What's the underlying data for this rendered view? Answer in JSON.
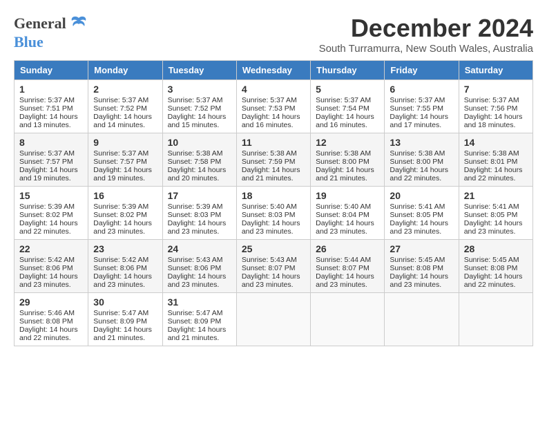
{
  "logo": {
    "general": "General",
    "blue": "Blue"
  },
  "title": "December 2024",
  "subtitle": "South Turramurra, New South Wales, Australia",
  "weekdays": [
    "Sunday",
    "Monday",
    "Tuesday",
    "Wednesday",
    "Thursday",
    "Friday",
    "Saturday"
  ],
  "weeks": [
    [
      {
        "day": "1",
        "sunrise": "Sunrise: 5:37 AM",
        "sunset": "Sunset: 7:51 PM",
        "daylight": "Daylight: 14 hours and 13 minutes."
      },
      {
        "day": "2",
        "sunrise": "Sunrise: 5:37 AM",
        "sunset": "Sunset: 7:52 PM",
        "daylight": "Daylight: 14 hours and 14 minutes."
      },
      {
        "day": "3",
        "sunrise": "Sunrise: 5:37 AM",
        "sunset": "Sunset: 7:52 PM",
        "daylight": "Daylight: 14 hours and 15 minutes."
      },
      {
        "day": "4",
        "sunrise": "Sunrise: 5:37 AM",
        "sunset": "Sunset: 7:53 PM",
        "daylight": "Daylight: 14 hours and 16 minutes."
      },
      {
        "day": "5",
        "sunrise": "Sunrise: 5:37 AM",
        "sunset": "Sunset: 7:54 PM",
        "daylight": "Daylight: 14 hours and 16 minutes."
      },
      {
        "day": "6",
        "sunrise": "Sunrise: 5:37 AM",
        "sunset": "Sunset: 7:55 PM",
        "daylight": "Daylight: 14 hours and 17 minutes."
      },
      {
        "day": "7",
        "sunrise": "Sunrise: 5:37 AM",
        "sunset": "Sunset: 7:56 PM",
        "daylight": "Daylight: 14 hours and 18 minutes."
      }
    ],
    [
      {
        "day": "8",
        "sunrise": "Sunrise: 5:37 AM",
        "sunset": "Sunset: 7:57 PM",
        "daylight": "Daylight: 14 hours and 19 minutes."
      },
      {
        "day": "9",
        "sunrise": "Sunrise: 5:37 AM",
        "sunset": "Sunset: 7:57 PM",
        "daylight": "Daylight: 14 hours and 19 minutes."
      },
      {
        "day": "10",
        "sunrise": "Sunrise: 5:38 AM",
        "sunset": "Sunset: 7:58 PM",
        "daylight": "Daylight: 14 hours and 20 minutes."
      },
      {
        "day": "11",
        "sunrise": "Sunrise: 5:38 AM",
        "sunset": "Sunset: 7:59 PM",
        "daylight": "Daylight: 14 hours and 21 minutes."
      },
      {
        "day": "12",
        "sunrise": "Sunrise: 5:38 AM",
        "sunset": "Sunset: 8:00 PM",
        "daylight": "Daylight: 14 hours and 21 minutes."
      },
      {
        "day": "13",
        "sunrise": "Sunrise: 5:38 AM",
        "sunset": "Sunset: 8:00 PM",
        "daylight": "Daylight: 14 hours and 22 minutes."
      },
      {
        "day": "14",
        "sunrise": "Sunrise: 5:38 AM",
        "sunset": "Sunset: 8:01 PM",
        "daylight": "Daylight: 14 hours and 22 minutes."
      }
    ],
    [
      {
        "day": "15",
        "sunrise": "Sunrise: 5:39 AM",
        "sunset": "Sunset: 8:02 PM",
        "daylight": "Daylight: 14 hours and 22 minutes."
      },
      {
        "day": "16",
        "sunrise": "Sunrise: 5:39 AM",
        "sunset": "Sunset: 8:02 PM",
        "daylight": "Daylight: 14 hours and 23 minutes."
      },
      {
        "day": "17",
        "sunrise": "Sunrise: 5:39 AM",
        "sunset": "Sunset: 8:03 PM",
        "daylight": "Daylight: 14 hours and 23 minutes."
      },
      {
        "day": "18",
        "sunrise": "Sunrise: 5:40 AM",
        "sunset": "Sunset: 8:03 PM",
        "daylight": "Daylight: 14 hours and 23 minutes."
      },
      {
        "day": "19",
        "sunrise": "Sunrise: 5:40 AM",
        "sunset": "Sunset: 8:04 PM",
        "daylight": "Daylight: 14 hours and 23 minutes."
      },
      {
        "day": "20",
        "sunrise": "Sunrise: 5:41 AM",
        "sunset": "Sunset: 8:05 PM",
        "daylight": "Daylight: 14 hours and 23 minutes."
      },
      {
        "day": "21",
        "sunrise": "Sunrise: 5:41 AM",
        "sunset": "Sunset: 8:05 PM",
        "daylight": "Daylight: 14 hours and 23 minutes."
      }
    ],
    [
      {
        "day": "22",
        "sunrise": "Sunrise: 5:42 AM",
        "sunset": "Sunset: 8:06 PM",
        "daylight": "Daylight: 14 hours and 23 minutes."
      },
      {
        "day": "23",
        "sunrise": "Sunrise: 5:42 AM",
        "sunset": "Sunset: 8:06 PM",
        "daylight": "Daylight: 14 hours and 23 minutes."
      },
      {
        "day": "24",
        "sunrise": "Sunrise: 5:43 AM",
        "sunset": "Sunset: 8:06 PM",
        "daylight": "Daylight: 14 hours and 23 minutes."
      },
      {
        "day": "25",
        "sunrise": "Sunrise: 5:43 AM",
        "sunset": "Sunset: 8:07 PM",
        "daylight": "Daylight: 14 hours and 23 minutes."
      },
      {
        "day": "26",
        "sunrise": "Sunrise: 5:44 AM",
        "sunset": "Sunset: 8:07 PM",
        "daylight": "Daylight: 14 hours and 23 minutes."
      },
      {
        "day": "27",
        "sunrise": "Sunrise: 5:45 AM",
        "sunset": "Sunset: 8:08 PM",
        "daylight": "Daylight: 14 hours and 23 minutes."
      },
      {
        "day": "28",
        "sunrise": "Sunrise: 5:45 AM",
        "sunset": "Sunset: 8:08 PM",
        "daylight": "Daylight: 14 hours and 22 minutes."
      }
    ],
    [
      {
        "day": "29",
        "sunrise": "Sunrise: 5:46 AM",
        "sunset": "Sunset: 8:08 PM",
        "daylight": "Daylight: 14 hours and 22 minutes."
      },
      {
        "day": "30",
        "sunrise": "Sunrise: 5:47 AM",
        "sunset": "Sunset: 8:09 PM",
        "daylight": "Daylight: 14 hours and 21 minutes."
      },
      {
        "day": "31",
        "sunrise": "Sunrise: 5:47 AM",
        "sunset": "Sunset: 8:09 PM",
        "daylight": "Daylight: 14 hours and 21 minutes."
      },
      null,
      null,
      null,
      null
    ]
  ]
}
